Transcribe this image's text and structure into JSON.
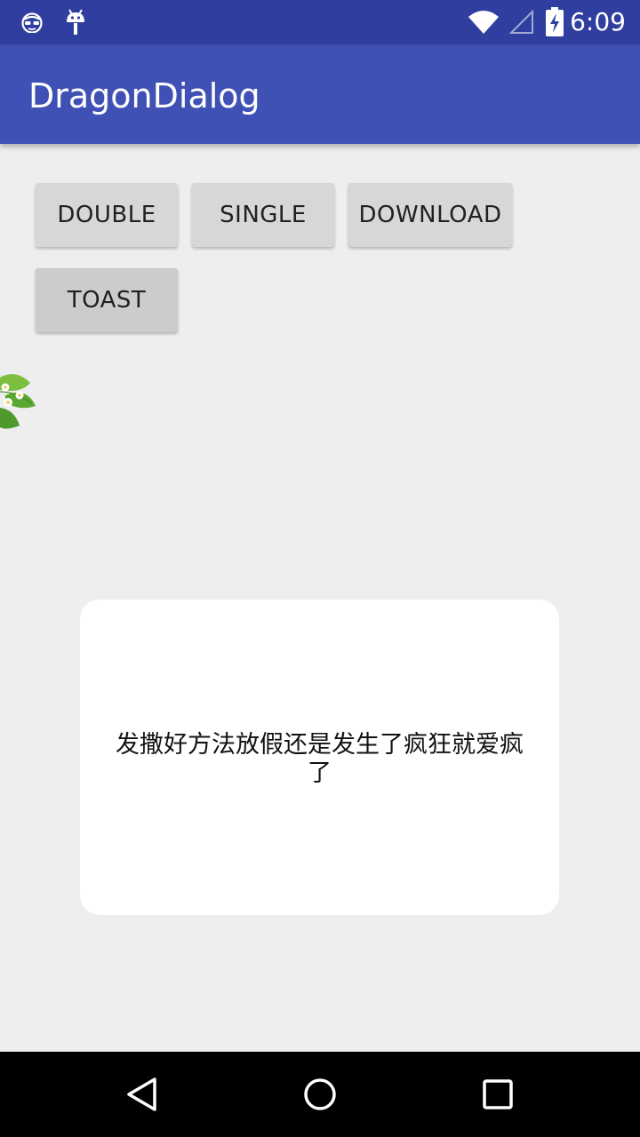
{
  "status_bar": {
    "time": "6:09",
    "left_icons": [
      "incognito-icon",
      "android-debug-icon"
    ],
    "right_icons": [
      "wifi-icon",
      "signal-icon",
      "battery-charging-icon"
    ]
  },
  "app_bar": {
    "title": "DragonDialog",
    "color": "#3f51b5",
    "status_color": "#303f9f"
  },
  "buttons": [
    {
      "label": "DOUBLE"
    },
    {
      "label": "SINGLE"
    },
    {
      "label": "DOWNLOAD"
    },
    {
      "label": "TOAST"
    }
  ],
  "dialog": {
    "message": "发撒好方法放假还是发生了疯狂就爱疯了"
  },
  "nav_bar": {
    "icons": [
      "back-icon",
      "home-icon",
      "recents-icon"
    ]
  }
}
